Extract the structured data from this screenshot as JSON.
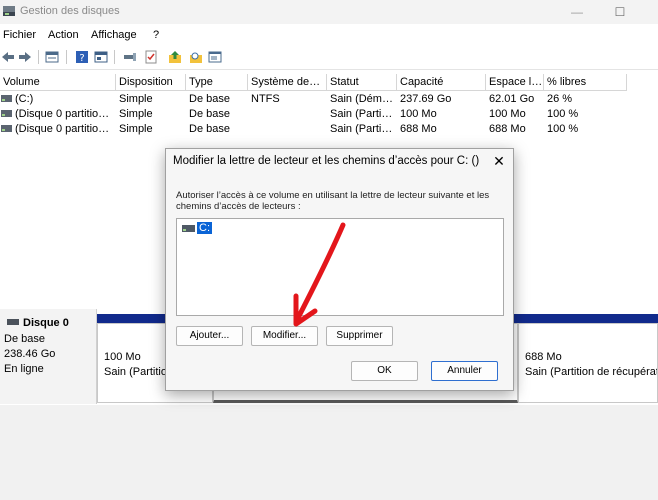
{
  "window": {
    "title": "Gestion des disques",
    "minimize_glyph": "—",
    "maximize_glyph": "☐"
  },
  "menu": [
    "Fichier",
    "Action",
    "Affichage",
    "?"
  ],
  "toolbar_icons": [
    "back-arrow-icon",
    "forward-arrow-icon",
    "properties-grid-icon",
    "help-icon",
    "console-pane-icon",
    "connect-icon",
    "checklist-icon",
    "up-arrow-folder-icon",
    "search-folder-icon",
    "settings-window-icon"
  ],
  "columns": [
    "Volume",
    "Disposition",
    "Type",
    "Système de…",
    "Statut",
    "Capacité",
    "Espace l…",
    "% libres"
  ],
  "volumes": [
    [
      "(C:)",
      "Simple",
      "De base",
      "NTFS",
      "Sain (Dém…",
      "237.69 Go",
      "62.01 Go",
      "26 %"
    ],
    [
      "(Disque 0 partitio…",
      "Simple",
      "De base",
      "",
      "Sain (Parti…",
      "100 Mo",
      "100 Mo",
      "100 %"
    ],
    [
      "(Disque 0 partitio…",
      "Simple",
      "De base",
      "",
      "Sain (Parti…",
      "688 Mo",
      "688 Mo",
      "100 %"
    ]
  ],
  "disk": {
    "name": "Disque 0",
    "type": "De base",
    "size": "238.46 Go",
    "status": "En ligne",
    "partitions": [
      {
        "size": "100 Mo",
        "status": "Sain (Partitio"
      },
      {
        "size": "688 Mo",
        "status": "Sain (Partition de récupérat"
      }
    ]
  },
  "dialog": {
    "title": "Modifier la lettre de lecteur et les chemins d’accès pour C: ()",
    "close_glyph": "✕",
    "description": "Autoriser l’accès à ce volume en utilisant la lettre de lecteur suivante et les chemins d’accès de lecteurs :",
    "selected_item": "C:",
    "buttons": {
      "add": "Ajouter...",
      "modify": "Modifier...",
      "delete": "Supprimer",
      "ok": "OK",
      "cancel": "Annuler"
    }
  },
  "colors": {
    "partition_header": "#112a8c",
    "selection": "#0a64d6",
    "annotation": "#e3161b"
  }
}
